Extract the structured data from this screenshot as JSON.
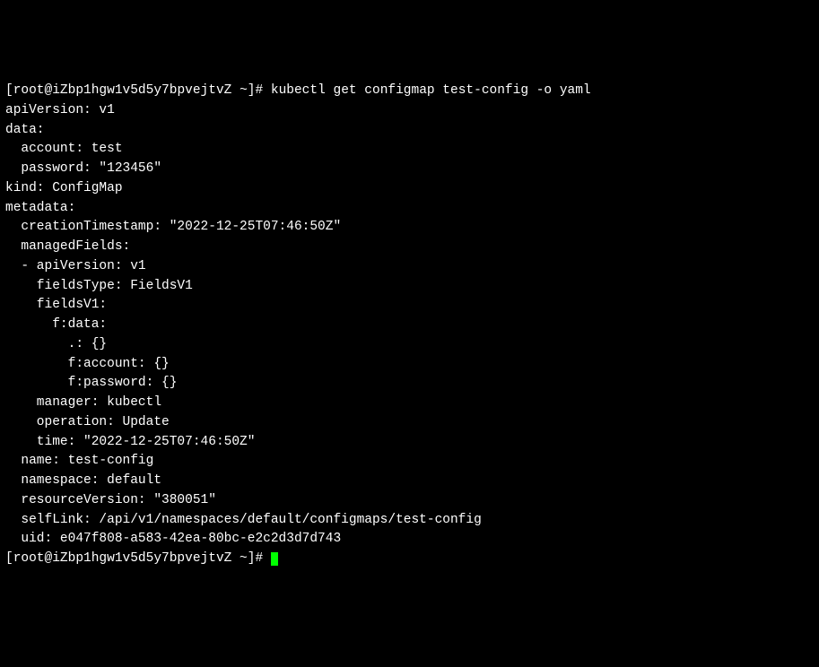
{
  "prompt": {
    "user": "root",
    "host": "iZbp1hgw1v5d5y7bpvejtvZ",
    "cwd": "~",
    "symbol": "#"
  },
  "command": "kubectl get configmap test-config -o yaml",
  "output": {
    "apiVersion_key": "apiVersion:",
    "apiVersion_val": " v1",
    "data_key": "data:",
    "account_line": "  account: test",
    "password_line": "  password: \"123456\"",
    "kind_line": "kind: ConfigMap",
    "metadata_key": "metadata:",
    "creationTimestamp_line": "  creationTimestamp: \"2022-12-25T07:46:50Z\"",
    "managedFields_key": "  managedFields:",
    "mf_apiVersion": "  - apiVersion: v1",
    "mf_fieldsType": "    fieldsType: FieldsV1",
    "mf_fieldsV1": "    fieldsV1:",
    "mf_fdata": "      f:data:",
    "mf_dot": "        .: {}",
    "mf_faccount": "        f:account: {}",
    "mf_fpassword": "        f:password: {}",
    "mf_manager": "    manager: kubectl",
    "mf_operation": "    operation: Update",
    "mf_time": "    time: \"2022-12-25T07:46:50Z\"",
    "name_line": "  name: test-config",
    "namespace_line": "  namespace: default",
    "resourceVersion_line": "  resourceVersion: \"380051\"",
    "selfLink_line": "  selfLink: /api/v1/namespaces/default/configmaps/test-config",
    "uid_line": "  uid: e047f808-a583-42ea-80bc-e2c2d3d7d743"
  },
  "prompt2_raw": "[root@iZbp1hgw1v5d5y7bpvejtvZ ~]# "
}
